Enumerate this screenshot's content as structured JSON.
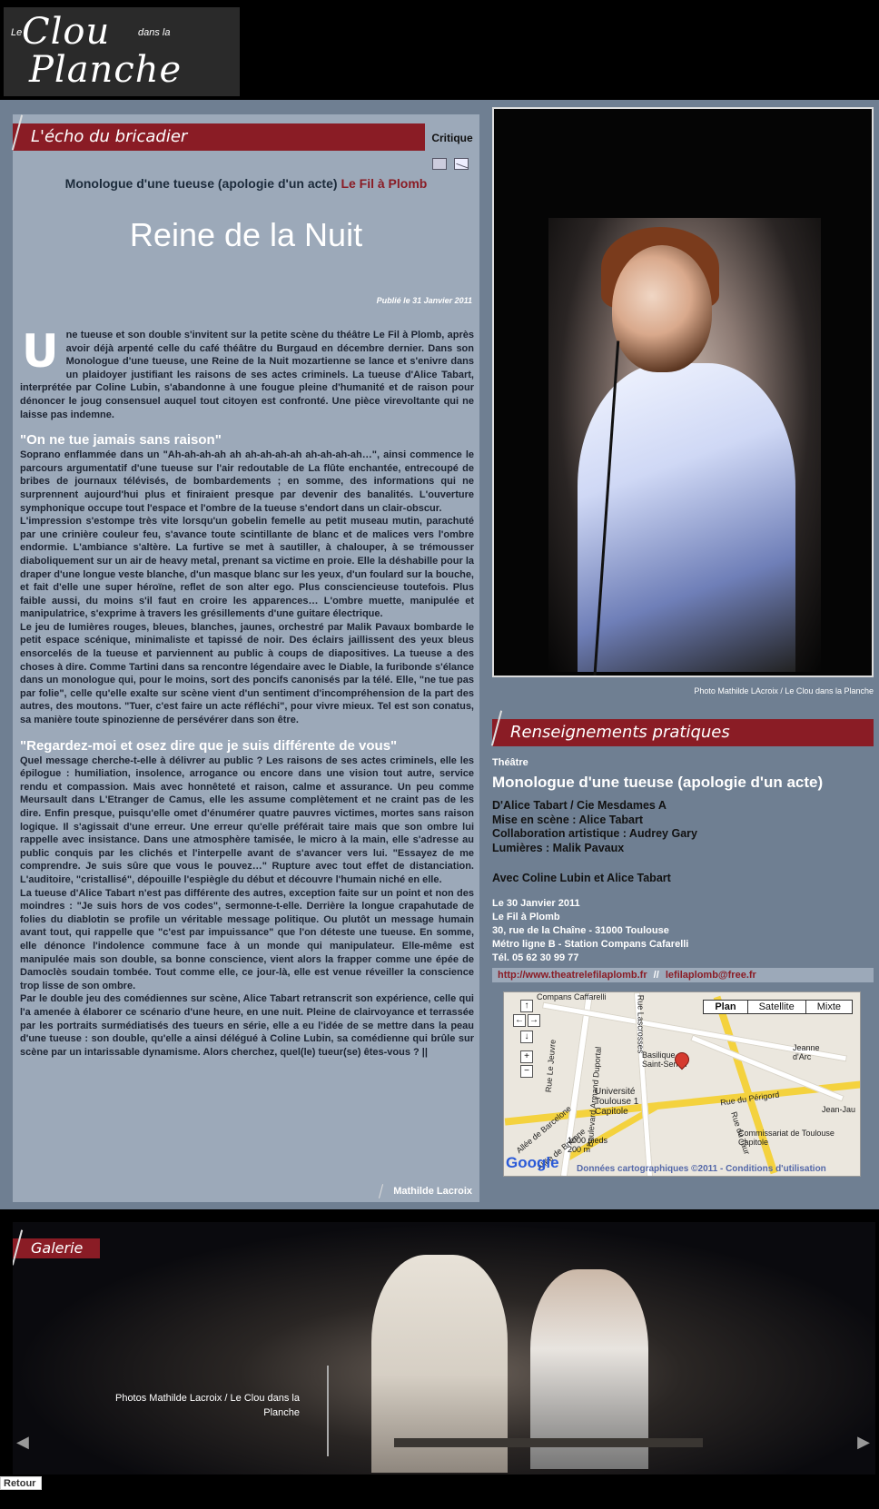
{
  "header": {
    "logo_text_le": "Le",
    "logo_text_clou": "Clou",
    "logo_text_dans": "dans la",
    "logo_text_planche": "Planche"
  },
  "article": {
    "section_title": "L'écho du bricadier",
    "tag": "Critique",
    "show_title": "Monologue d'une tueuse (apologie d'un acte)",
    "venue": "Le Fil à Plomb",
    "title": "Reine de la Nuit",
    "published": "Publié le 31 Janvier 2011",
    "dropcap": "U",
    "lead": "ne tueuse et son double s'invitent sur la petite scène du théâtre Le Fil à Plomb, après avoir déjà arpenté celle du café théâtre du Burgaud en décembre dernier. Dans son Monologue d'une tueuse, une Reine de la Nuit mozartienne se lance et s'enivre dans un plaidoyer justifiant les raisons de ses actes criminels. La tueuse d'Alice Tabart, interprétée par Coline Lubin, s'abandonne à une fougue pleine d'humanité et de raison pour dénoncer le joug consensuel auquel tout citoyen est confronté. Une pièce virevoltante qui ne laisse pas indemne.",
    "subhead1": "\"On ne tue jamais sans raison\"",
    "para1": "Soprano enflammée dans un \"Ah-ah-ah-ah ah ah-ah-ah-ah ah-ah-ah-ah…\", ainsi commence le parcours argumentatif d'une tueuse sur l'air redoutable de La flûte enchantée, entrecoupé de bribes de journaux télévisés, de bombardements ; en somme, des informations qui ne surprennent aujourd'hui plus et finiraient presque par devenir des banalités. L'ouverture symphonique occupe tout l'espace et l'ombre de la tueuse s'endort dans un clair-obscur.",
    "para2": "L'impression s'estompe très vite lorsqu'un gobelin femelle au petit museau mutin, parachuté par une crinière couleur feu, s'avance toute scintillante de blanc et de malices vers l'ombre endormie. L'ambiance s'altère. La furtive se met à sautiller, à chalouper, à se trémousser diaboliquement sur un air de heavy metal, prenant sa victime en proie. Elle la déshabille pour la draper d'une longue veste blanche, d'un masque blanc sur les yeux, d'un foulard sur la bouche, et fait d'elle une super héroïne, reflet de son alter ego. Plus consciencieuse toutefois. Plus faible aussi, du moins s'il faut en croire les apparences… L'ombre muette, manipulée et manipulatrice, s'exprime à travers les grésillements d'une guitare électrique.",
    "para3": "Le jeu de lumières rouges, bleues, blanches, jaunes, orchestré par Malik Pavaux bombarde le petit espace scénique, minimaliste et tapissé de noir. Des éclairs jaillissent des yeux bleus ensorcelés de la tueuse et parviennent au public à coups de diapositives. La tueuse a des choses à dire. Comme Tartini dans sa rencontre légendaire avec le Diable, la furibonde s'élance dans un monologue qui, pour le moins, sort des poncifs canonisés par la télé. Elle, \"ne tue pas par folie\", celle qu'elle exalte sur scène vient d'un sentiment d'incompréhension de la part des autres, des moutons. \"Tuer, c'est faire un acte réfléchi\", pour vivre mieux. Tel est son conatus, sa manière toute spinozienne de persévérer dans son être.",
    "subhead2": "\"Regardez-moi et osez dire que je suis différente de vous\"",
    "para4": "Quel message cherche-t-elle à délivrer au public ? Les raisons de ses actes criminels, elle les épilogue : humiliation, insolence, arrogance ou encore dans une vision tout autre, service rendu et compassion. Mais avec honnêteté et raison, calme et assurance. Un peu comme Meursault dans L'Etranger de Camus, elle les assume complètement et ne craint pas de les dire. Enfin presque, puisqu'elle omet d'énumérer quatre pauvres victimes, mortes sans raison logique. Il s'agissait d'une erreur. Une erreur qu'elle préférait taire mais que son ombre lui rappelle avec insistance. Dans une atmosphère tamisée, le micro à la main, elle s'adresse au public conquis par les clichés et l'interpelle avant de s'avancer vers lui. \"Essayez de me comprendre. Je suis sûre que vous le pouvez…\" Rupture avec tout effet de distanciation. L'auditoire, \"cristallisé\", dépouille l'espiègle du début et découvre l'humain niché en elle.",
    "para5": "La tueuse d'Alice Tabart n'est pas différente des autres, exception faite sur un point et non des moindres : \"Je suis hors de vos codes\", sermonne-t-elle. Derrière la longue crapahutade de folies du diablotin se profile un véritable message politique. Ou plutôt un message humain avant tout, qui rappelle que \"c'est par impuissance\" que l'on déteste une tueuse. En somme, elle dénonce l'indolence commune face à un monde qui manipulateur. Elle-même est manipulée mais son double, sa bonne conscience, vient alors la frapper comme une épée de Damoclès soudain tombée. Tout comme elle, ce jour-là, elle est venue réveiller la conscience trop lisse de son ombre.",
    "para6": "Par le double jeu des comédiennes sur scène, Alice Tabart retranscrit son expérience, celle qui l'a amenée à élaborer ce scénario d'une heure, en une nuit. Pleine de clairvoyance et terrassée par les portraits surmédiatisés des tueurs en série, elle a eu l'idée de se mettre dans la peau d'une tueuse : son double, qu'elle a ainsi délégué à Coline Lubin, sa comédienne qui brûle sur scène par un intarissable dynamisme. Alors cherchez, quel(le) tueur(se) êtes-vous ? ||",
    "author": "Mathilde Lacroix"
  },
  "photo": {
    "credit": "Photo Mathilde LAcroix / Le Clou dans la Planche"
  },
  "practical": {
    "section_title": "Renseignements pratiques",
    "genre": "Théâtre",
    "title": "Monologue d'une tueuse (apologie d'un acte)",
    "credit1": "D'Alice Tabart / Cie Mesdames A",
    "credit2": "Mise en scène : Alice Tabart",
    "credit3": "Collaboration artistique : Audrey Gary",
    "credit4": "Lumières : Malik Pavaux",
    "cast": "Avec Coline Lubin et Alice Tabart",
    "date": "Le 30 Janvier 2011",
    "venue": "Le Fil à Plomb",
    "address": "30, rue de la Chaîne - 31000 Toulouse",
    "metro": "Métro ligne B - Station Compans Cafarelli",
    "phone": "Tél. 05 62 30 99 77",
    "website": "http://www.theatrelefilaplomb.fr",
    "separator": "//",
    "email": "lefilaplomb@free.fr"
  },
  "map": {
    "btn_plan": "Plan",
    "btn_satellite": "Satellite",
    "btn_mixte": "Mixte",
    "label_compans": "Compans Caffarelli",
    "label_lascrosses": "Rue Lascrosses",
    "label_dupont": "Boulevard Armand Duportal",
    "label_jeuvre": "Rue Le Jeuvre",
    "label_univ": "Université Toulouse 1 Capitole",
    "label_saint": "Basilique Saint-Sernin",
    "label_jeanne": "Jeanne d'Arc",
    "label_perigord": "Rue du Périgord",
    "label_jeanjau": "Jean-Jau",
    "label_barcelone": "Allée de Barcelone",
    "label_brienne": "Allée de Brienne",
    "label_taur": "Rue du Taur",
    "label_commissariat": "Commissariat de Toulouse Capitole",
    "scale_ft": "1000 pieds",
    "scale_m": "200 m",
    "google": "Google",
    "footer": "Données cartographiques ©2011 - Conditions d'utilisation"
  },
  "gallery": {
    "section_title": "Galerie",
    "caption": "Photos Mathilde Lacroix / Le Clou dans la Planche",
    "prev": "◀",
    "next": "▶"
  },
  "footer": {
    "back": "Retour"
  },
  "colors": {
    "accent": "#8a1c25",
    "panel": "#9ca9b9",
    "background": "#6f7f92"
  }
}
